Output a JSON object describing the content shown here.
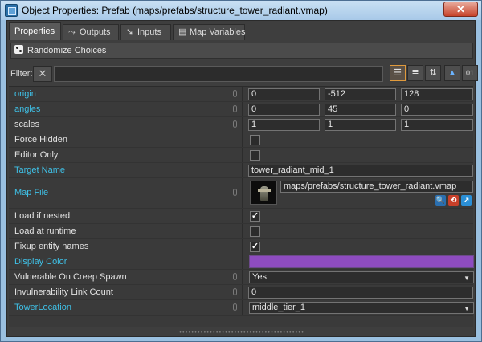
{
  "window": {
    "title": "Object Properties: Prefab (maps/prefabs/structure_tower_radiant.vmap)",
    "close_label": "✕"
  },
  "tabs": [
    {
      "label": "Properties",
      "icon": "properties-icon",
      "active": true
    },
    {
      "label": "Outputs",
      "icon": "outputs-icon",
      "active": false
    },
    {
      "label": "Inputs",
      "icon": "inputs-icon",
      "active": false
    },
    {
      "label": "Map Variables",
      "icon": "map-variables-icon",
      "active": false
    }
  ],
  "randomize_label": "Randomize Choices",
  "filter": {
    "label": "Filter:",
    "clear_label": "✕",
    "value": ""
  },
  "toolbar": {
    "view_list_label": "☰",
    "view_sorted_label": "≣",
    "view_az_label": "⇅",
    "pick_label": "▲",
    "binary_label": "01"
  },
  "properties": {
    "origin": {
      "label": "origin",
      "values": [
        "0",
        "-512",
        "128"
      ]
    },
    "angles": {
      "label": "angles",
      "values": [
        "0",
        "45",
        "0"
      ]
    },
    "scales": {
      "label": "scales",
      "values": [
        "1",
        "1",
        "1"
      ]
    },
    "force_hidden": {
      "label": "Force Hidden",
      "checked": false
    },
    "editor_only": {
      "label": "Editor Only",
      "checked": false
    },
    "target_name": {
      "label": "Target Name",
      "value": "tower_radiant_mid_1"
    },
    "map_file": {
      "label": "Map File",
      "value": "maps/prefabs/structure_tower_radiant.vmap"
    },
    "load_if_nested": {
      "label": "Load if nested",
      "checked": true,
      "mark": "✓"
    },
    "load_at_runtime": {
      "label": "Load at runtime",
      "checked": false
    },
    "fixup_entity_names": {
      "label": "Fixup entity names",
      "checked": true,
      "mark": "✓"
    },
    "display_color": {
      "label": "Display Color",
      "color": "#8e4cc0"
    },
    "vulnerable_on_creep_spawn": {
      "label": "Vulnerable On Creep Spawn",
      "value": "Yes"
    },
    "invulnerability_link_count": {
      "label": "Invulnerability Link Count",
      "value": "0"
    },
    "tower_location": {
      "label": "TowerLocation",
      "value": "middle_tier_1"
    }
  },
  "map_file_actions": [
    {
      "icon": "browse-icon",
      "glyph": "🔍"
    },
    {
      "icon": "reimport-icon",
      "glyph": "⟲"
    },
    {
      "icon": "open-map-icon",
      "glyph": "↗"
    }
  ],
  "splitter_grip": "•••••••••••••••••••••••••••••••••••••••••"
}
